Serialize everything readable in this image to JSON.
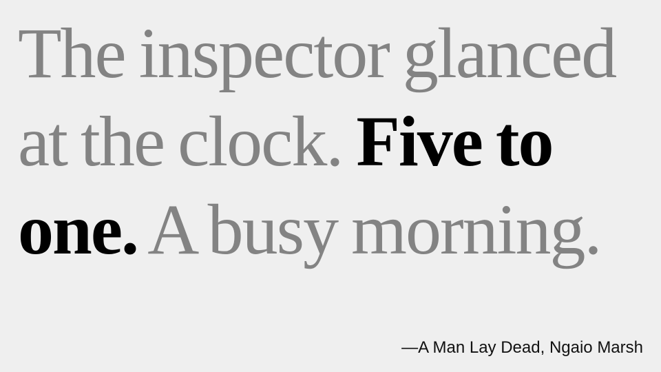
{
  "quote": {
    "line1": "The inspector glanced",
    "line2_plain": "at the clock. ",
    "line2_bold": "Five to",
    "line3_bold": "one.",
    "line3_plain": " A busy morning."
  },
  "attribution": "—A Man Lay Dead, Ngaio Marsh",
  "colors": {
    "background": "#efefef",
    "quote_text": "#838383",
    "emphasis_text": "#000000",
    "attribution_text": "#111111"
  }
}
